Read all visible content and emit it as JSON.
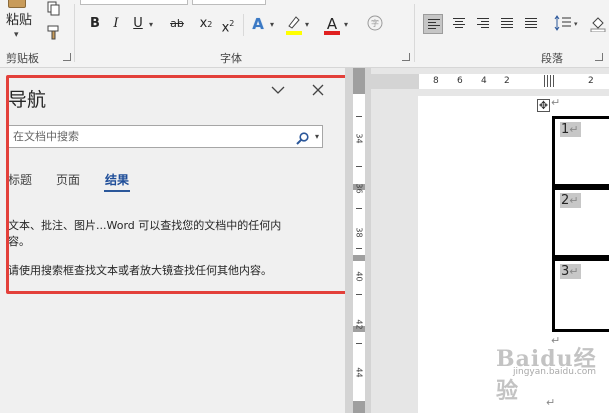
{
  "ribbon": {
    "clipboard": {
      "paste_label": "粘贴",
      "group_label": "剪贴板"
    },
    "font": {
      "group_label": "字体",
      "bold": "B",
      "italic": "I",
      "underline": "U",
      "strikethrough": "ab",
      "subscript": "x",
      "subscript_mark": "2",
      "superscript": "x",
      "superscript_mark": "2",
      "text_effects": "A",
      "font_color": "A",
      "highlight_color": "#ffff00",
      "font_color_value": "#e02020"
    },
    "paragraph": {
      "group_label": "段落"
    }
  },
  "nav_pane": {
    "title": "导航",
    "search_placeholder": "在文档中搜索",
    "tabs": [
      {
        "label": "标题",
        "active": false
      },
      {
        "label": "页面",
        "active": false
      },
      {
        "label": "结果",
        "active": true
      }
    ],
    "message_line1": "文本、批注、图片...Word 可以查找您的文档中的任何内",
    "message_line2": "容。",
    "message_line3": "请使用搜索框查找文本或者放大镜查找任何其他内容。"
  },
  "vruler": {
    "labels": [
      "34",
      "36",
      "38",
      "40",
      "42",
      "44"
    ]
  },
  "hruler": {
    "labels": [
      "8",
      "6",
      "4",
      "2",
      "2"
    ]
  },
  "document": {
    "cells": [
      {
        "text": "1"
      },
      {
        "text": "2"
      },
      {
        "text": "3"
      }
    ],
    "paragraph_mark": "↵",
    "move_handle": "✥"
  },
  "watermark": {
    "brand": "Baidu经验",
    "url": "jingyan.baidu.com"
  },
  "colors": {
    "accent": "#2b579a",
    "frame": "#e3403a"
  }
}
